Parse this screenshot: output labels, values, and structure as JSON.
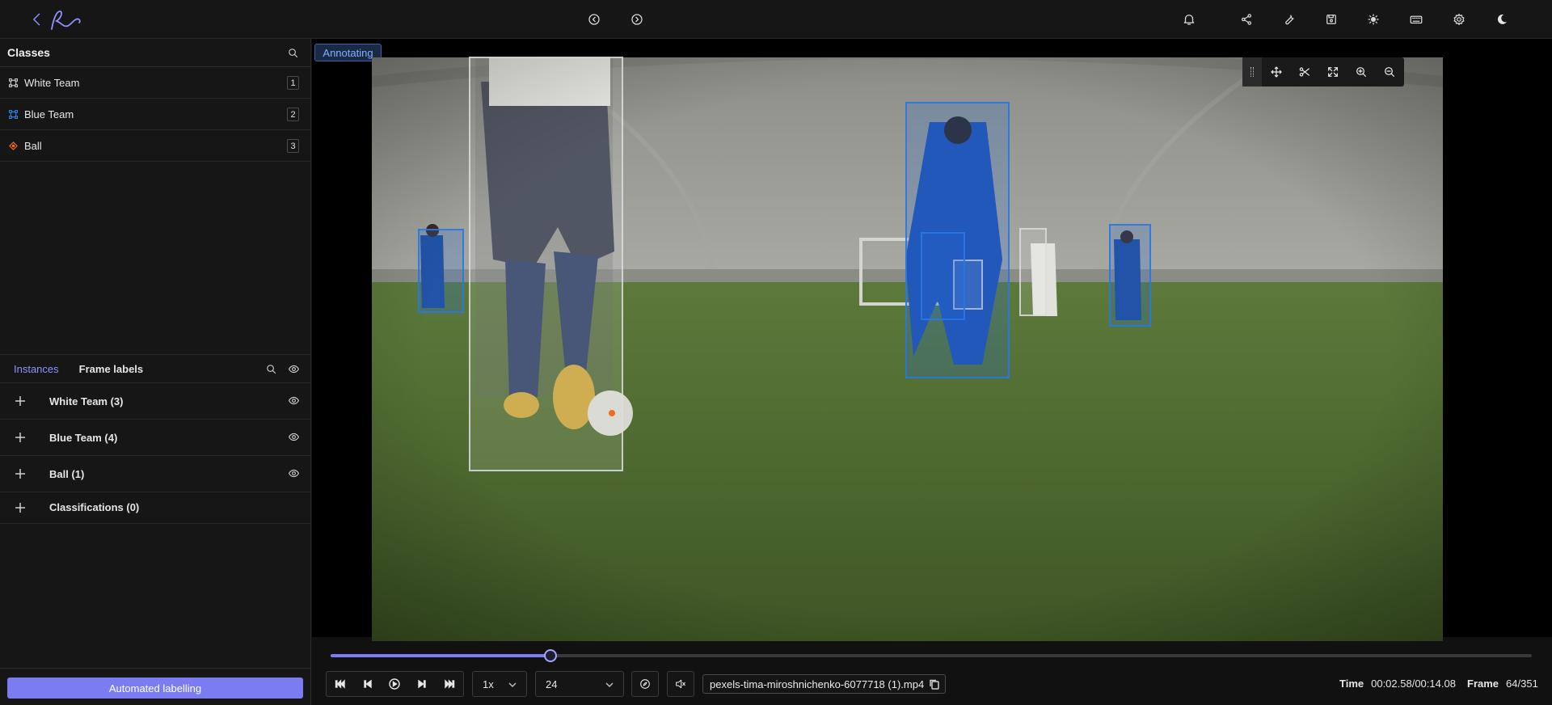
{
  "topbar": {
    "icons": [
      "back-icon",
      "logo",
      "history-back-icon",
      "history-forward-icon",
      "bell-icon",
      "share-icon",
      "wrench-icon",
      "save-icon",
      "brightness-icon",
      "keyboard-icon",
      "gear-icon",
      "moon-icon"
    ]
  },
  "classes": {
    "title": "Classes",
    "items": [
      {
        "name": "White Team",
        "hotkey": "1",
        "color": "#c8c8c8",
        "icon": "bbox-icon"
      },
      {
        "name": "Blue Team",
        "hotkey": "2",
        "color": "#2f7fe0",
        "icon": "bbox-icon"
      },
      {
        "name": "Ball",
        "hotkey": "3",
        "color": "#f26a1b",
        "icon": "keypoint-icon"
      }
    ]
  },
  "instances": {
    "tab_instances": "Instances",
    "tab_frame_labels": "Frame labels",
    "groups": [
      {
        "label": "White Team (3)",
        "has_eye": true
      },
      {
        "label": "Blue Team (4)",
        "has_eye": true
      },
      {
        "label": "Ball (1)",
        "has_eye": true
      },
      {
        "label": "Classifications (0)",
        "has_eye": false
      }
    ]
  },
  "canvas": {
    "status_badge": "Annotating"
  },
  "player": {
    "progress": 0.183,
    "speed": "1x",
    "fps": "24",
    "filename": "pexels-tima-miroshnichenko-6077718 (1).mp4",
    "time_label": "Time",
    "time_value": "00:02.58/00:14.08",
    "frame_label": "Frame",
    "frame_value": "64/351"
  },
  "actions": {
    "automated_labelling": "Automated labelling"
  },
  "colors": {
    "accent": "#7b7cf2",
    "white_team": "#c8c8c8",
    "blue_team": "#2f7fe0",
    "ball": "#f26a1b"
  }
}
